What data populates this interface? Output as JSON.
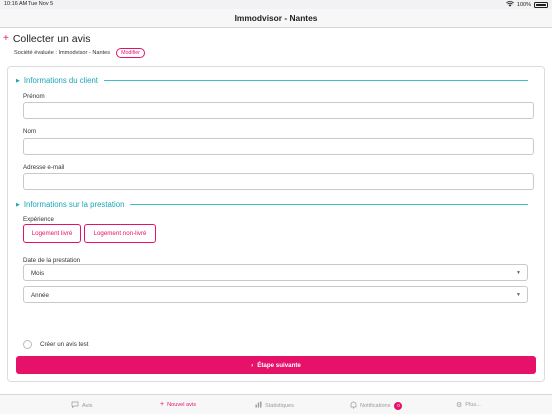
{
  "status_bar": {
    "time": "10:16 AM",
    "date": "Tue Nov 5",
    "battery": "100%"
  },
  "nav": {
    "title": "Immodvisor - Nantes"
  },
  "page": {
    "title": "Collecter un avis",
    "company_label": "Société évaluée : Immodvisor - Nantes",
    "modify_label": "Modifier"
  },
  "client_section": {
    "title": "Informations du client",
    "first_name_label": "Prénom",
    "last_name_label": "Nom",
    "email_label": "Adresse e-mail",
    "first_name_value": "",
    "last_name_value": "",
    "email_value": ""
  },
  "service_section": {
    "title": "Informations sur la prestation",
    "experience_label": "Expérience",
    "option_delivered": "Logement livré",
    "option_not_delivered": "Logement non-livré",
    "date_label": "Date de la prestation",
    "month_select": "Mois",
    "year_select": "Année",
    "test_review_label": "Créer un avis test"
  },
  "actions": {
    "next_step": "Étape suivante"
  },
  "tabs": [
    {
      "label": "Avis",
      "icon": "speech-bubble-icon"
    },
    {
      "label": "Nouvel avis",
      "icon": "plus-icon"
    },
    {
      "label": "Statistiques",
      "icon": "bar-chart-icon"
    },
    {
      "label": "Notifications",
      "icon": "bell-icon",
      "badge": "0"
    },
    {
      "label": "Plus...",
      "icon": "gear-icon"
    }
  ],
  "colors": {
    "accent": "#e6126a",
    "section": "#1aa6b7"
  }
}
